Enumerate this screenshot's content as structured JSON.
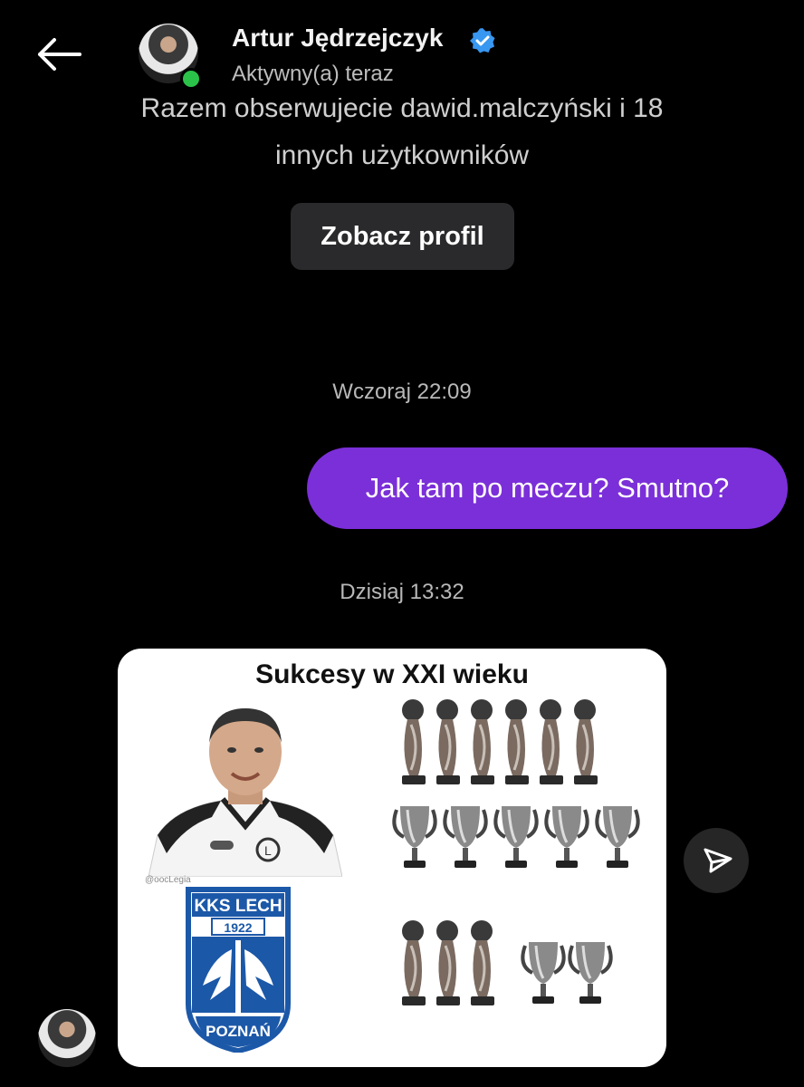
{
  "header": {
    "name": "Artur Jędrzejczyk",
    "status": "Aktywny(a) teraz",
    "verified": true,
    "online_color": "#2bc24a",
    "back_icon": "arrow-left-icon"
  },
  "profile_info": {
    "mutual_line1": "Razem obserwujecie dawid.malczyński i 18",
    "mutual_line2": "innych użytkowników",
    "view_profile_label": "Zobacz profil"
  },
  "messages": [
    {
      "timestamp": "Wczoraj 22:09",
      "text": "Jak tam po meczu? Smutno?",
      "from_me": true,
      "bubble_color": "#7b2fd8"
    },
    {
      "timestamp": "Dzisiaj 13:32",
      "type": "shared_post"
    }
  ],
  "shared_post": {
    "title": "Sukcesy w XXI wieku",
    "watermark": "@oocLegia",
    "club_badge": {
      "top": "KKS LECH",
      "year": "1922",
      "bottom": "POZNAŃ"
    },
    "row1": {
      "trophies": 6,
      "cups": 5
    },
    "row2": {
      "trophies": 3,
      "cups": 2
    }
  },
  "share_icon": "send-icon"
}
